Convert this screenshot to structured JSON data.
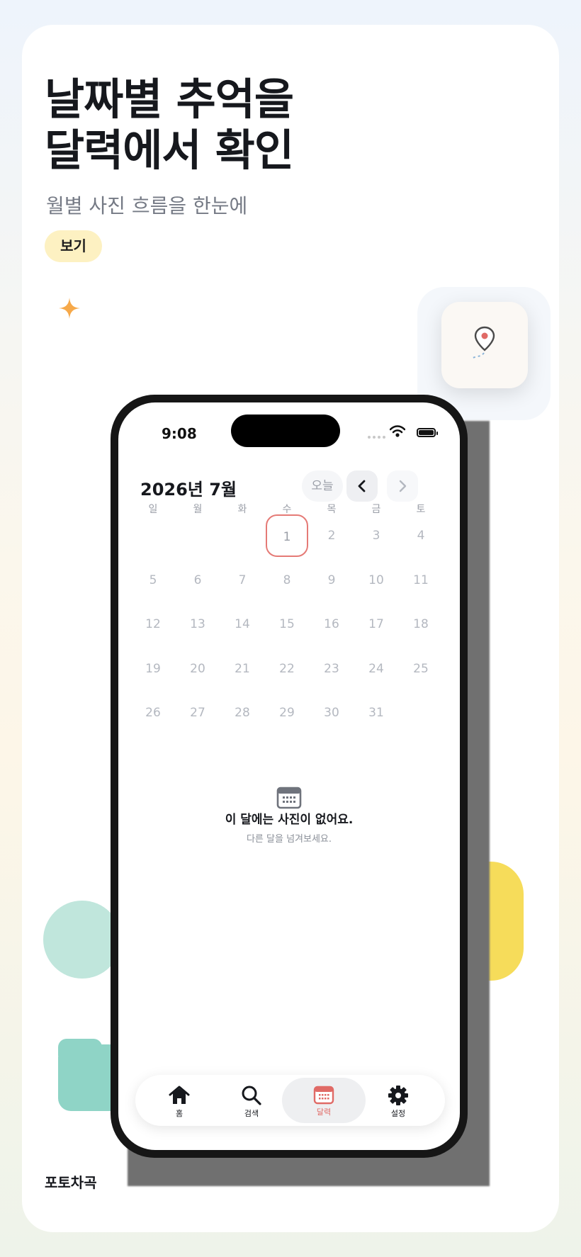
{
  "promo": {
    "headline_line1": "날짜별 추억을",
    "headline_line2": "달력에서 확인",
    "subtitle": "월별 사진 흐름을 한눈에",
    "pill_label": "보기",
    "brand": "포토차곡"
  },
  "status_bar": {
    "time": "9:08"
  },
  "calendar": {
    "month_title": "2026년 7월",
    "today_label": "오늘",
    "weekdays": [
      "일",
      "월",
      "화",
      "수",
      "목",
      "금",
      "토"
    ],
    "today_day": "1",
    "days": [
      "1",
      "2",
      "3",
      "4",
      "5",
      "6",
      "7",
      "8",
      "9",
      "10",
      "11",
      "12",
      "13",
      "14",
      "15",
      "16",
      "17",
      "18",
      "19",
      "20",
      "21",
      "22",
      "23",
      "24",
      "25",
      "26",
      "27",
      "28",
      "29",
      "30",
      "31"
    ],
    "first_weekday_index": 3
  },
  "empty_state": {
    "title": "이 달에는 사진이 없어요.",
    "subtitle": "다른 달을 넘겨보세요."
  },
  "tabbar": {
    "items": [
      {
        "label": "홈",
        "icon": "home-icon"
      },
      {
        "label": "검색",
        "icon": "search-icon"
      },
      {
        "label": "달력",
        "icon": "calendar-icon",
        "active": true
      },
      {
        "label": "설정",
        "icon": "gear-icon"
      }
    ]
  },
  "colors": {
    "accent": "#e06a66",
    "pill_bg": "#fdf1c2",
    "sparkle": "#f6a94a",
    "teal": "#8fd4c6",
    "yellow": "#f6dc5a"
  }
}
